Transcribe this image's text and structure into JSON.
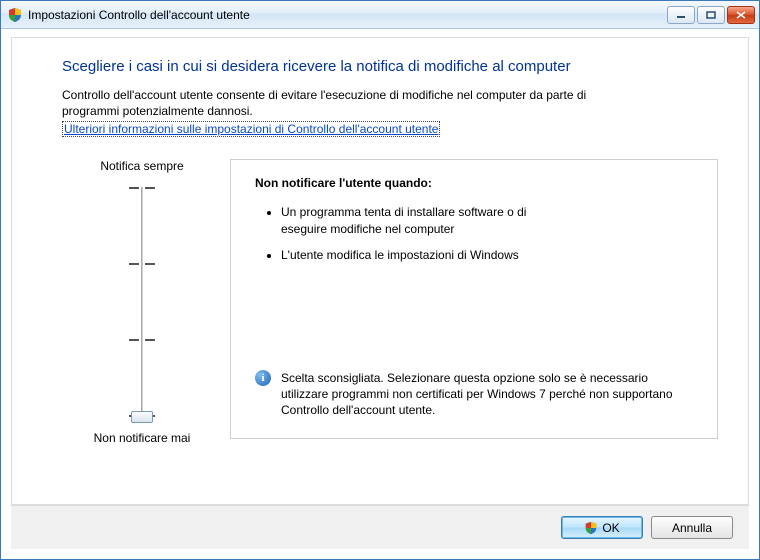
{
  "titlebar": {
    "title": "Impostazioni Controllo dell'account utente"
  },
  "heading": "Scegliere i casi in cui si desidera ricevere la notifica di modifiche al computer",
  "description": "Controllo dell'account utente consente di evitare l'esecuzione di modifiche nel computer da parte di programmi potenzialmente dannosi.",
  "link_text": "Ulteriori informazioni sulle impostazioni di Controllo dell'account utente",
  "slider": {
    "top_label": "Notifica sempre",
    "bottom_label": "Non notificare mai"
  },
  "panel": {
    "title": "Non notificare l'utente quando:",
    "bullets": [
      "Un programma tenta di installare software o di eseguire modifiche nel computer",
      "L'utente modifica le impostazioni di Windows"
    ],
    "recommendation": "Scelta sconsigliata. Selezionare questa opzione solo se è necessario utilizzare programmi non certificati per Windows 7 perché non supportano Controllo dell'account utente."
  },
  "buttons": {
    "ok": "OK",
    "cancel": "Annulla"
  }
}
